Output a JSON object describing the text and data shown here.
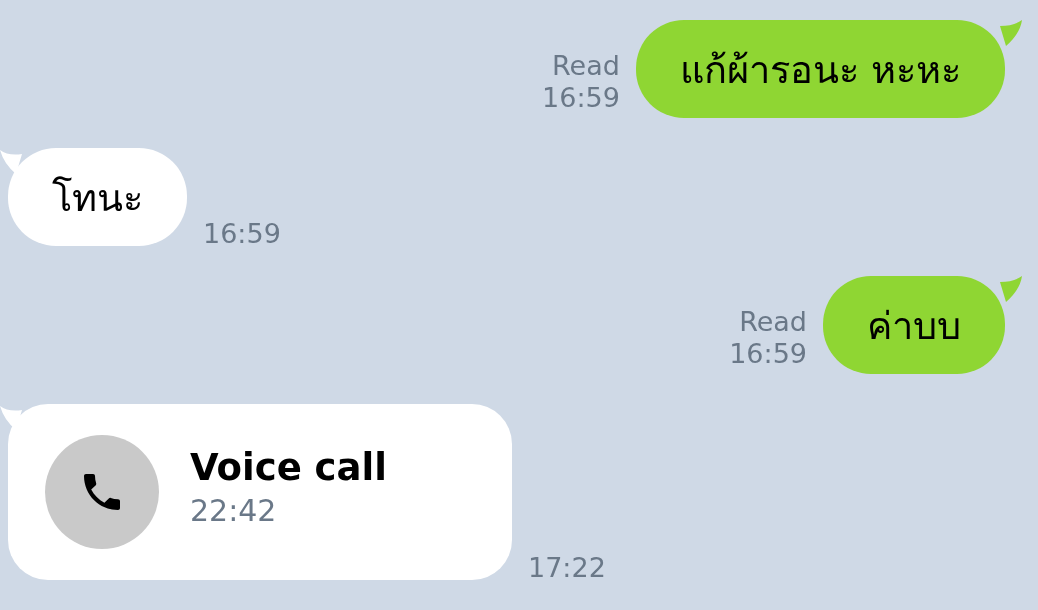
{
  "messages": [
    {
      "kind": "text",
      "outgoing": true,
      "text": "แก้ผ้ารอนะ หะหะ",
      "read_label": "Read",
      "time": "16:59"
    },
    {
      "kind": "text",
      "outgoing": false,
      "text": "โทนะ",
      "time": "16:59"
    },
    {
      "kind": "text",
      "outgoing": true,
      "text": "ค่าบบ",
      "read_label": "Read",
      "time": "16:59"
    },
    {
      "kind": "call",
      "outgoing": false,
      "title": "Voice call",
      "duration": "22:42",
      "time": "17:22"
    }
  ]
}
